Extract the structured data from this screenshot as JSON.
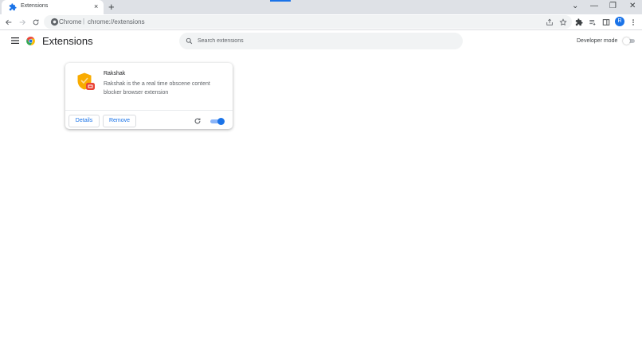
{
  "browser": {
    "tab": {
      "title": "Extensions",
      "close_glyph": "×"
    },
    "new_tab_glyph": "+",
    "window_controls": {
      "tabsearch": "⌄",
      "minimize": "—",
      "maximize": "❐",
      "close": "✕"
    },
    "omnibox": {
      "site_label": "Chrome",
      "separator": "|",
      "url": "chrome://extensions"
    },
    "profile_initial": "R"
  },
  "page": {
    "title": "Extensions",
    "search": {
      "placeholder": "Search extensions"
    },
    "developer_mode": {
      "label": "Developer mode",
      "enabled": false
    }
  },
  "extensions": [
    {
      "name": "Rakshak",
      "description": "Rakshak is the a real time obscene content blocker browser extension",
      "details_label": "Details",
      "remove_label": "Remove",
      "enabled": true
    }
  ],
  "colors": {
    "accent": "#1a73e8",
    "shield": "#f9ab00",
    "badge": "#ea4335"
  }
}
